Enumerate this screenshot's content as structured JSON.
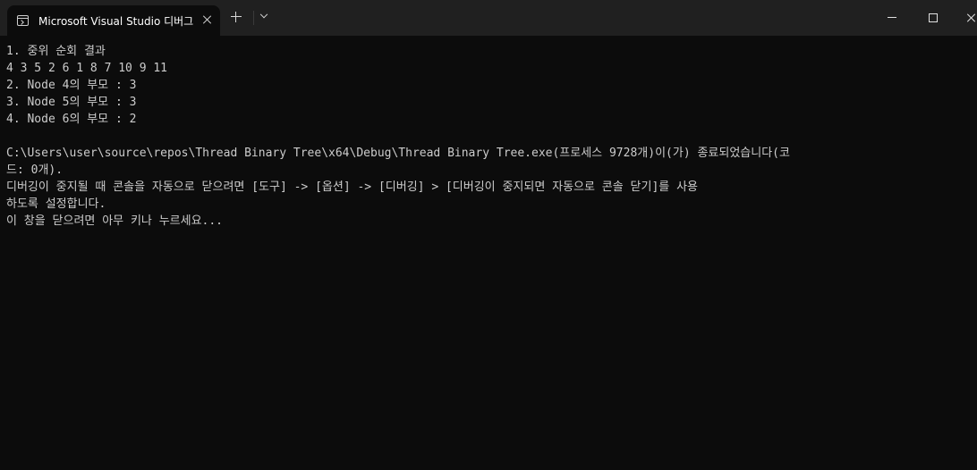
{
  "window": {
    "tab_title": "Microsoft Visual Studio 디버그"
  },
  "console": {
    "lines": [
      "1. 중위 순회 결과",
      "4 3 5 2 6 1 8 7 10 9 11",
      "2. Node 4의 부모 : 3",
      "3. Node 5의 부모 : 3",
      "4. Node 6의 부모 : 2",
      "",
      "C:\\Users\\user\\source\\repos\\Thread Binary Tree\\x64\\Debug\\Thread Binary Tree.exe(프로세스 9728개)이(가) 종료되었습니다(코",
      "드: 0개).",
      "디버깅이 중지될 때 콘솔을 자동으로 닫으려면 [도구] -> [옵션] -> [디버깅] > [디버깅이 중지되면 자동으로 콘솔 닫기]를 사용",
      "하도록 설정합니다.",
      "이 창을 닫으려면 아무 키나 누르세요..."
    ]
  },
  "colors": {
    "titlebar": "#202020",
    "console_bg": "#0c0c0c",
    "console_text": "#cccccc"
  },
  "icons": {
    "tab": "terminal-icon",
    "close_tab": "close-icon",
    "new_tab": "plus-icon",
    "dropdown": "chevron-down-icon",
    "minimize": "minimize-icon",
    "maximize": "maximize-icon",
    "close_window": "close-icon"
  }
}
